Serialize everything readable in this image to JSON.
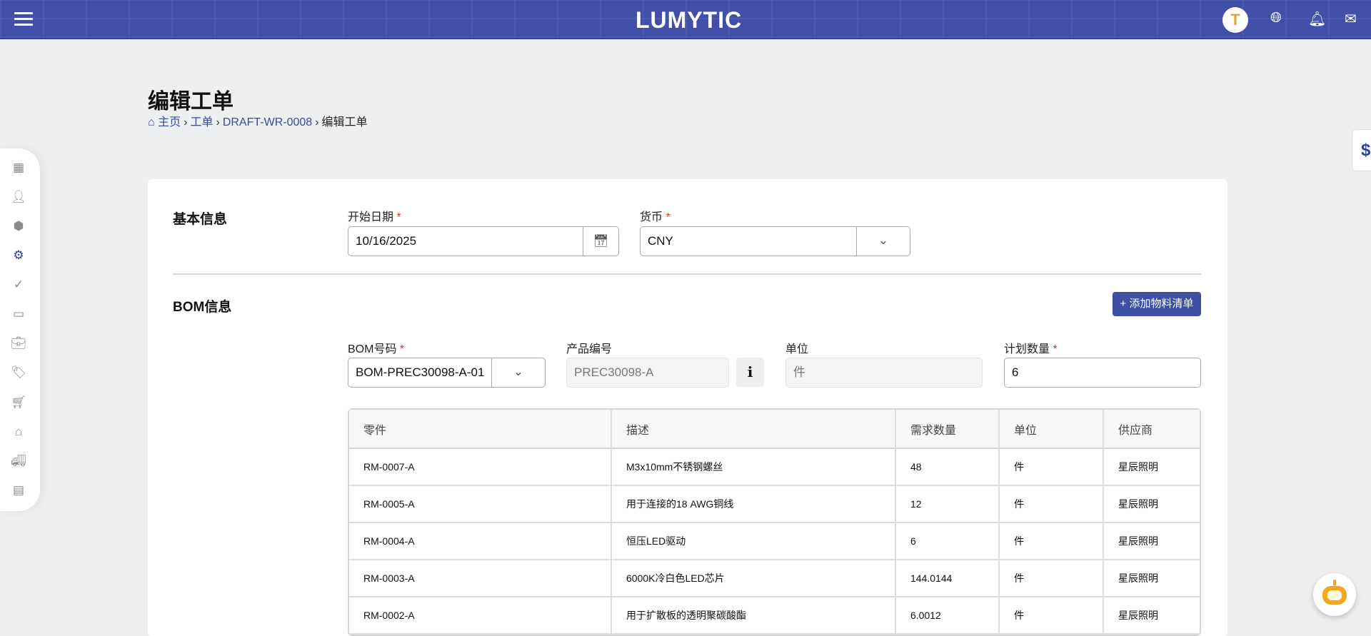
{
  "header": {
    "logo": "LUMYTIC",
    "avatar_initial": "T"
  },
  "page": {
    "title": "编辑工单",
    "breadcrumb": [
      "主页",
      "工单",
      "DRAFT-WR-0008",
      "编辑工单"
    ]
  },
  "basic": {
    "section_title": "基本信息",
    "start_date_label": "开始日期",
    "start_date": "10/16/2025",
    "currency_label": "货币",
    "currency": "CNY",
    "required_mark": "*"
  },
  "bom": {
    "section_title": "BOM信息",
    "add_button": "+ 添加物料清单",
    "bom_no_label": "BOM号码",
    "bom_no": "BOM-PREC30098-A-01",
    "product_label": "产品编号",
    "product": "PREC30098-A",
    "info_label": "i",
    "unit_label": "单位",
    "unit": "件",
    "qty_label": "计划数量",
    "qty": "6"
  },
  "table": {
    "headers": [
      "零件",
      "描述",
      "需求数量",
      "单位",
      "供应商"
    ],
    "rows": [
      [
        "RM-0007-A",
        "M3x10mm不锈钢螺丝",
        "48",
        "件",
        "星辰照明"
      ],
      [
        "RM-0005-A",
        "用于连接的18 AWG铜线",
        "12",
        "件",
        "星辰照明"
      ],
      [
        "RM-0004-A",
        "恒压LED驱动",
        "6",
        "件",
        "星辰照明"
      ],
      [
        "RM-0003-A",
        "6000K冷白色LED芯片",
        "144.0144",
        "件",
        "星辰照明"
      ],
      [
        "RM-0002-A",
        "用于扩散板的透明聚碳酸酯",
        "6.0012",
        "件",
        "星辰照明"
      ]
    ]
  },
  "side_tab": {
    "symbol": "$"
  },
  "colors": {
    "primary": "#3d4ea5",
    "header": "#4050a8",
    "required": "#dd3333"
  }
}
